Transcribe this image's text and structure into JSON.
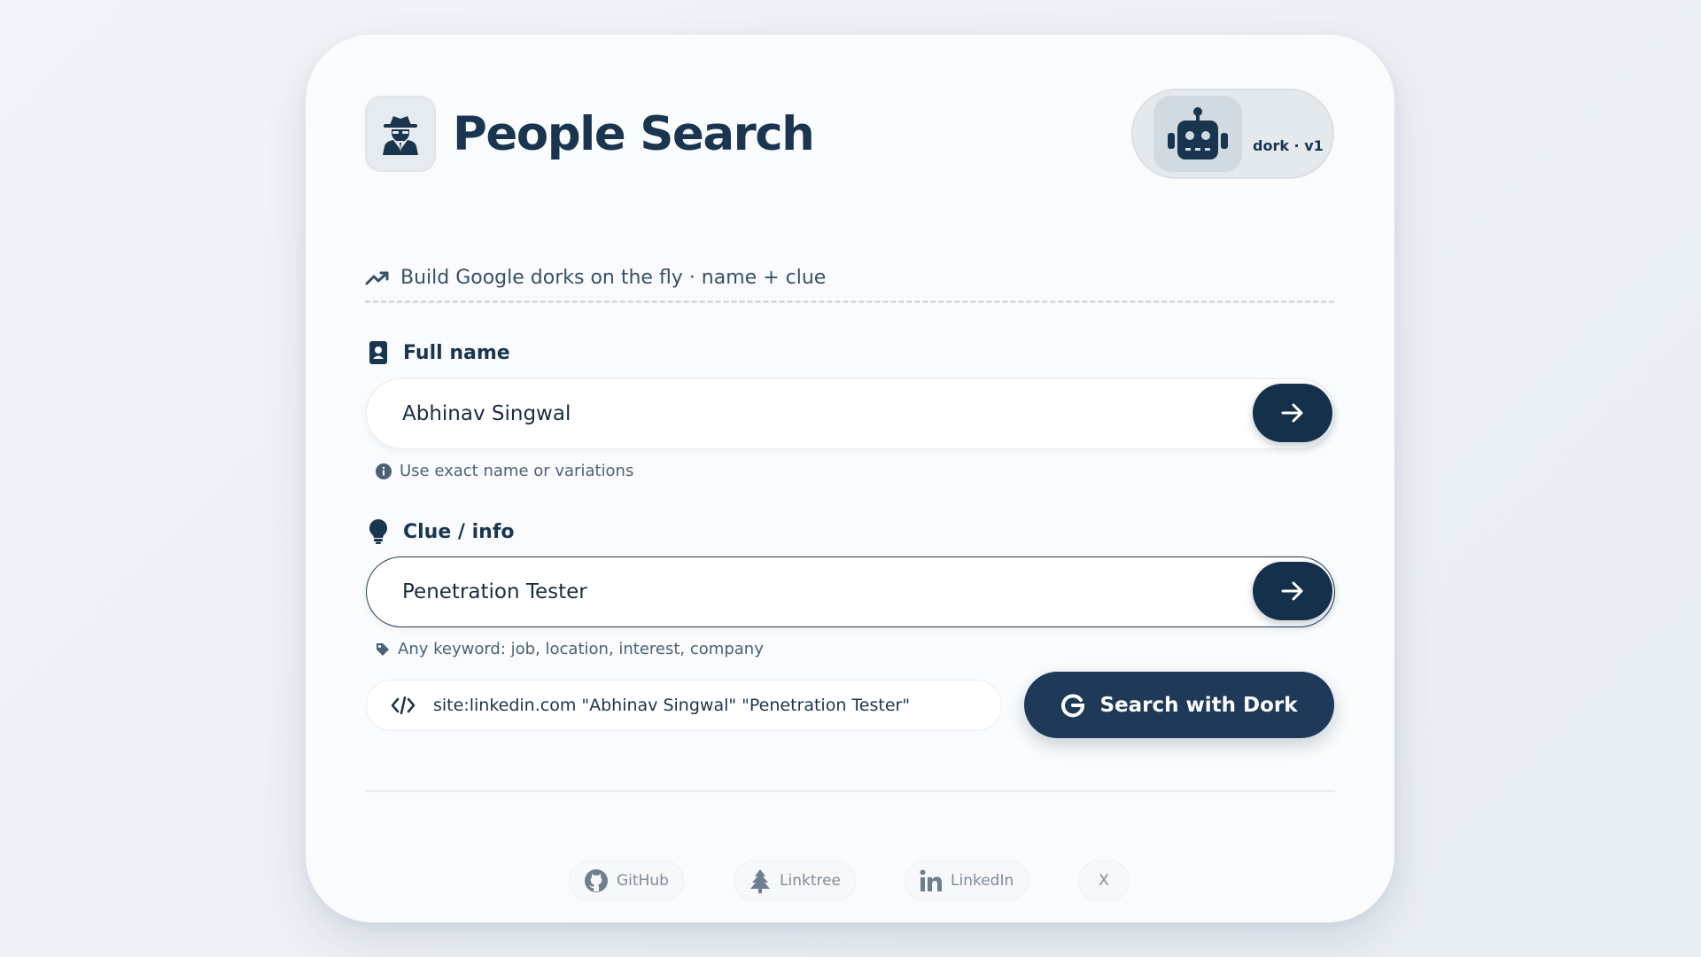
{
  "app": {
    "title": "People Search"
  },
  "badge": {
    "text": "dork · v1"
  },
  "subtitle": "Build Google dorks on the fly · name + clue",
  "fields": {
    "name": {
      "label": "Full name",
      "value": "Abhinav Singwal",
      "hint": "Use exact name or variations"
    },
    "clue": {
      "label": "Clue / info",
      "value": "Penetration Tester",
      "hint": "Any keyword: job, location, interest, company"
    }
  },
  "dork": {
    "preview": "site:linkedin.com \"Abhinav Singwal\" \"Penetration Tester\""
  },
  "search_button": {
    "label": "Search with Dork"
  },
  "footer": {
    "links": [
      {
        "label": "GitHub",
        "icon": "github-icon"
      },
      {
        "label": "Linktree",
        "icon": "tree-icon"
      },
      {
        "label": "LinkedIn",
        "icon": "linkedin-icon"
      },
      {
        "label": "X",
        "icon": ""
      }
    ]
  },
  "colors": {
    "primary": "#1a3550",
    "button": "#1e3a58",
    "background": "#f9fbfc"
  }
}
